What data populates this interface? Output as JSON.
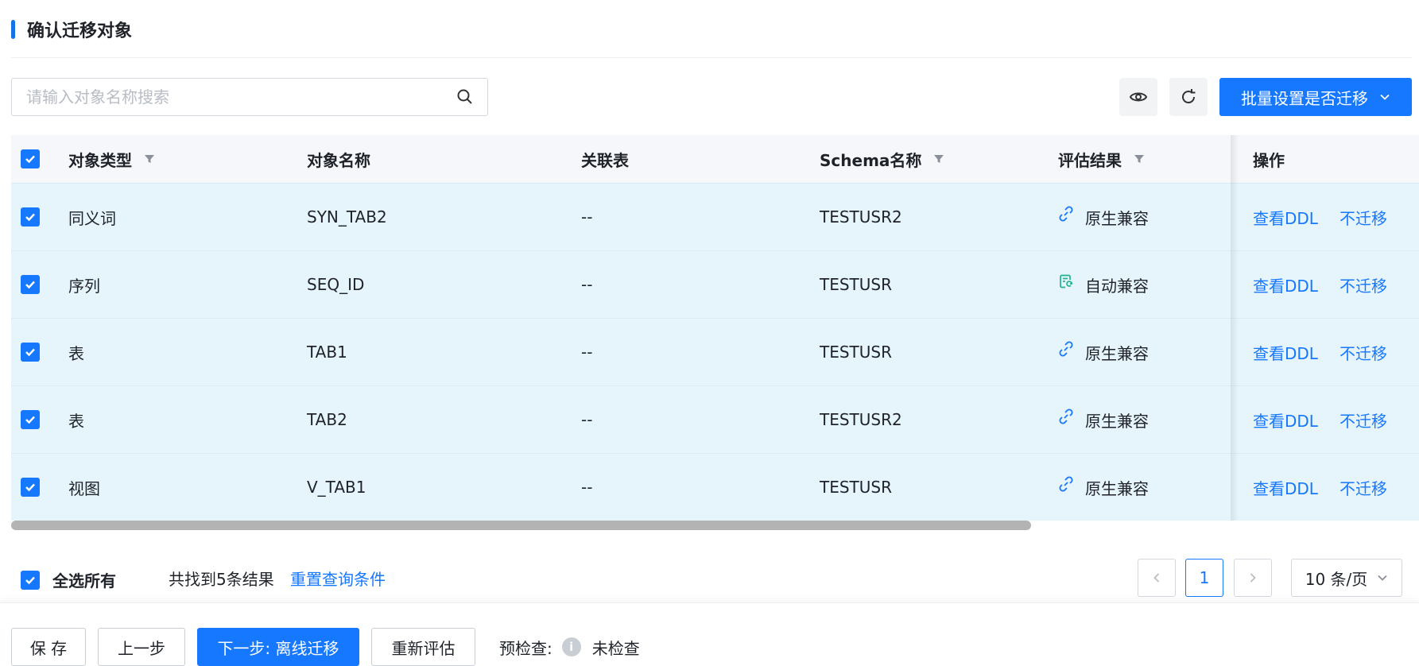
{
  "section": {
    "title": "确认迁移对象"
  },
  "search": {
    "placeholder": "请输入对象名称搜索"
  },
  "toolbar": {
    "bulk_label": "批量设置是否迁移"
  },
  "table": {
    "columns": [
      "对象类型",
      "对象名称",
      "关联表",
      "Schema名称",
      "评估结果",
      "操作"
    ],
    "rows": [
      {
        "type": "同义词",
        "name": "SYN_TAB2",
        "related": "--",
        "schema": "TESTUSR2",
        "eval": "原生兼容",
        "eval_icon": "link-icon",
        "op_view": "查看DDL",
        "op_skip": "不迁移"
      },
      {
        "type": "序列",
        "name": "SEQ_ID",
        "related": "--",
        "schema": "TESTUSR",
        "eval": "自动兼容",
        "eval_icon": "auto-convert-icon",
        "op_view": "查看DDL",
        "op_skip": "不迁移"
      },
      {
        "type": "表",
        "name": "TAB1",
        "related": "--",
        "schema": "TESTUSR",
        "eval": "原生兼容",
        "eval_icon": "link-icon",
        "op_view": "查看DDL",
        "op_skip": "不迁移"
      },
      {
        "type": "表",
        "name": "TAB2",
        "related": "--",
        "schema": "TESTUSR2",
        "eval": "原生兼容",
        "eval_icon": "link-icon",
        "op_view": "查看DDL",
        "op_skip": "不迁移"
      },
      {
        "type": "视图",
        "name": "V_TAB1",
        "related": "--",
        "schema": "TESTUSR",
        "eval": "原生兼容",
        "eval_icon": "link-icon",
        "op_view": "查看DDL",
        "op_skip": "不迁移"
      }
    ]
  },
  "footer": {
    "select_all": "全选所有",
    "count_text": "共找到5条结果",
    "reset_link": "重置查询条件",
    "current_page": "1",
    "page_size": "10 条/页"
  },
  "actions": {
    "save": "保 存",
    "prev": "上一步",
    "next": "下一步: 离线迁移",
    "reassess": "重新评估",
    "precheck_label": "预检查:",
    "precheck_status": "未检查"
  },
  "colors": {
    "primary": "#1677ff",
    "row_bg": "#e6f5fc",
    "auto_icon": "#1fb48c"
  }
}
